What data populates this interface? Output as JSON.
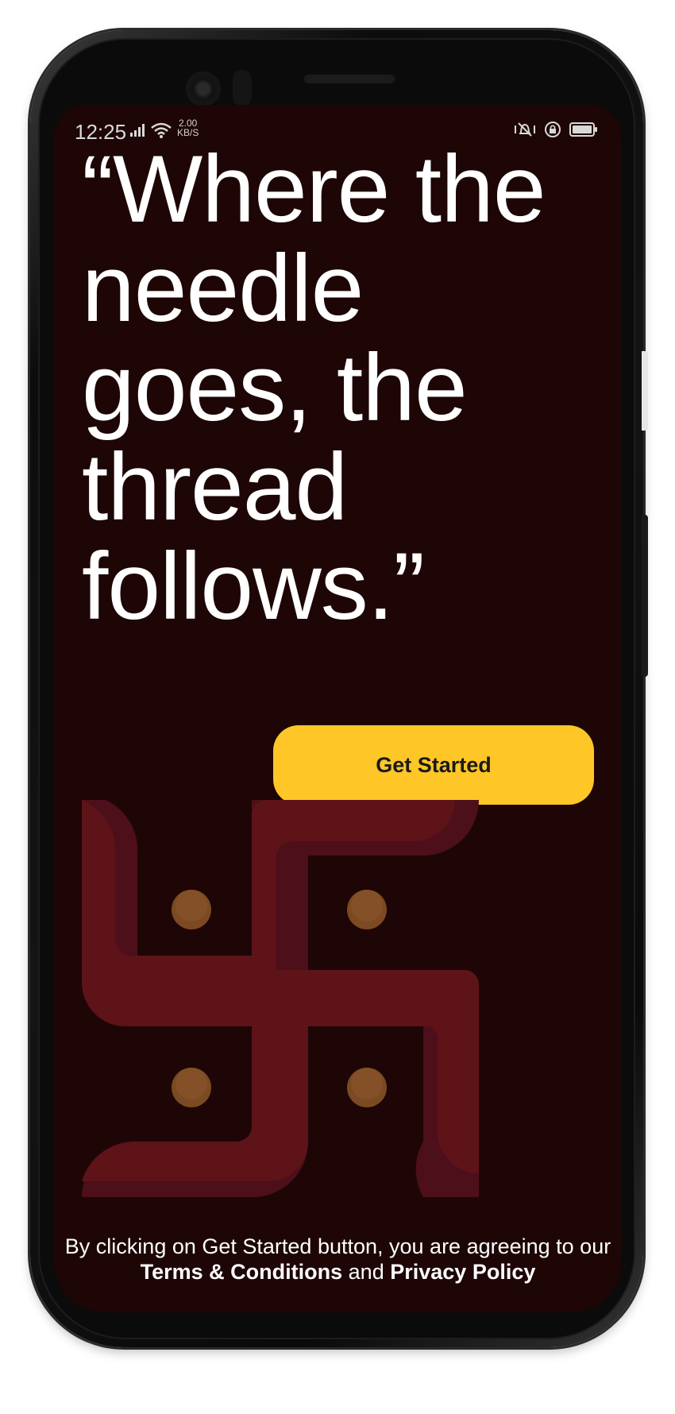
{
  "status_bar": {
    "time": "12:25",
    "net_speed_value": "2.00",
    "net_speed_unit": "KB/S"
  },
  "quote": {
    "text": "“Where the needle goes, the thread follows.”"
  },
  "get_started_button": {
    "label": "Get Started"
  },
  "legal": {
    "prefix": "By clicking on Get Started button, you are agreeing to our",
    "terms_link": "Terms & Conditions",
    "conjunction": "and",
    "privacy_link": "Privacy Policy"
  },
  "icons": {
    "status": [
      "signal-icon",
      "wifi-icon",
      "vibrate-icon",
      "rotation-lock-icon",
      "battery-icon"
    ],
    "illustration": "swastika-icon"
  },
  "colors": {
    "screen_background": "#1e0606",
    "button_background": "#fec627",
    "symbol_primary": "#5e1318",
    "symbol_shade": "#4d0f1a",
    "dot": "#7b4a23"
  }
}
